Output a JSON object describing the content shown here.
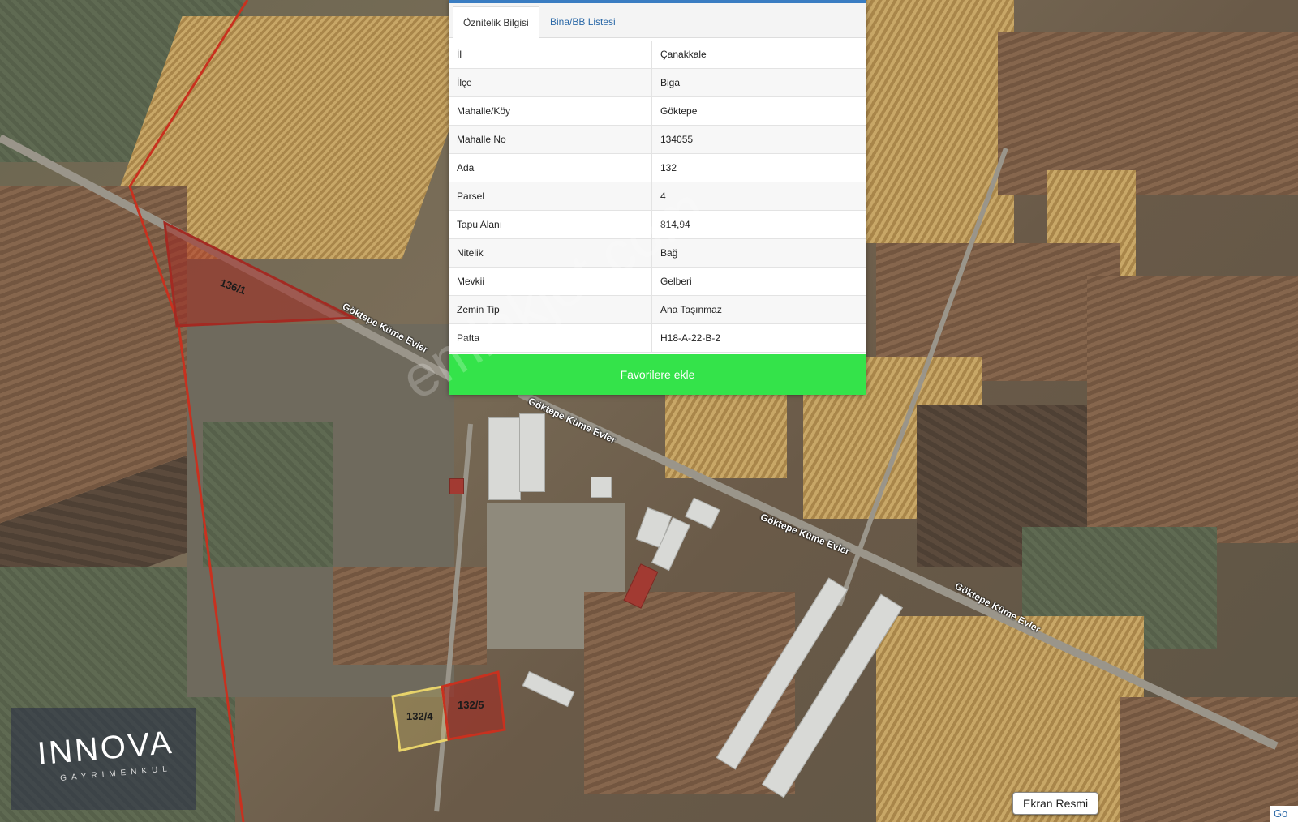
{
  "tabs": {
    "active": "Öznitelik Bilgisi",
    "other": "Bina/BB Listesi"
  },
  "rows": [
    {
      "key": "İl",
      "value": "Çanakkale"
    },
    {
      "key": "İlçe",
      "value": "Biga"
    },
    {
      "key": "Mahalle/Köy",
      "value": "Göktepe"
    },
    {
      "key": "Mahalle No",
      "value": "134055"
    },
    {
      "key": "Ada",
      "value": "132"
    },
    {
      "key": "Parsel",
      "value": "4"
    },
    {
      "key": "Tapu Alanı",
      "value": "814,94"
    },
    {
      "key": "Nitelik",
      "value": "Bağ"
    },
    {
      "key": "Mevkii",
      "value": "Gelberi"
    },
    {
      "key": "Zemin Tip",
      "value": "Ana Taşınmaz"
    },
    {
      "key": "Pafta",
      "value": "H18-A-22-B-2"
    }
  ],
  "button": {
    "favorite": "Favorilere ekle"
  },
  "map": {
    "parcels": {
      "p1": "136/1",
      "p2": "132/4",
      "p3": "132/5"
    },
    "roads": {
      "r1": "Göktepe Küme Evler",
      "r2": "Göktepe Küme Evler",
      "r3": "Göktepe Küme Evler",
      "r4": "Göktepe Küme Evler"
    }
  },
  "watermark": "emlakjet.com",
  "logo": {
    "main": "INNOVA",
    "sub": "GAYRIMENKUL"
  },
  "ekran_button": "Ekran Resmi",
  "corner_text": "Go",
  "colors": {
    "panel_accent": "#3a7dc2",
    "favorite_button": "#34e34a",
    "parcel_red": "#a32a22",
    "parcel_yellow": "#e8d36a"
  }
}
